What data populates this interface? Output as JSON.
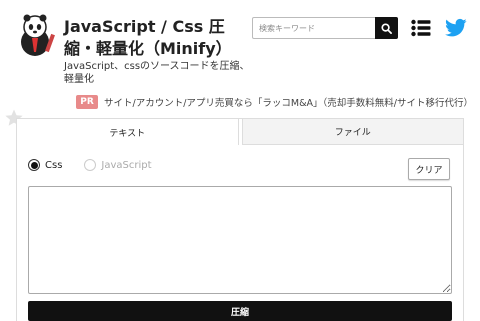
{
  "header": {
    "title": "JavaScript / Css 圧縮・軽量化（Minify）",
    "description": "JavaScript、cssのソースコードを圧縮、軽量化",
    "logo_icon": "mascot-logo-icon"
  },
  "search": {
    "placeholder": "検索キーワード",
    "value": "",
    "button_icon": "search-icon"
  },
  "nav": {
    "menu_icon": "list-menu-icon",
    "social_icon": "twitter-icon",
    "twitter_color": "#1da1f2"
  },
  "ad": {
    "badge": "PR",
    "text": "サイト/アカウント/アプリ売買なら「ラッコM&A」（売却手数料無料/サイト移行代行）",
    "badge_color": "#e88a8a"
  },
  "tabs": [
    {
      "label": "テキスト",
      "active": true
    },
    {
      "label": "ファイル",
      "active": false
    }
  ],
  "options": {
    "css_label": "Css",
    "js_label": "JavaScript",
    "selected": "Css"
  },
  "buttons": {
    "clear": "クリア",
    "compress": "圧縮"
  },
  "editor": {
    "value": ""
  }
}
